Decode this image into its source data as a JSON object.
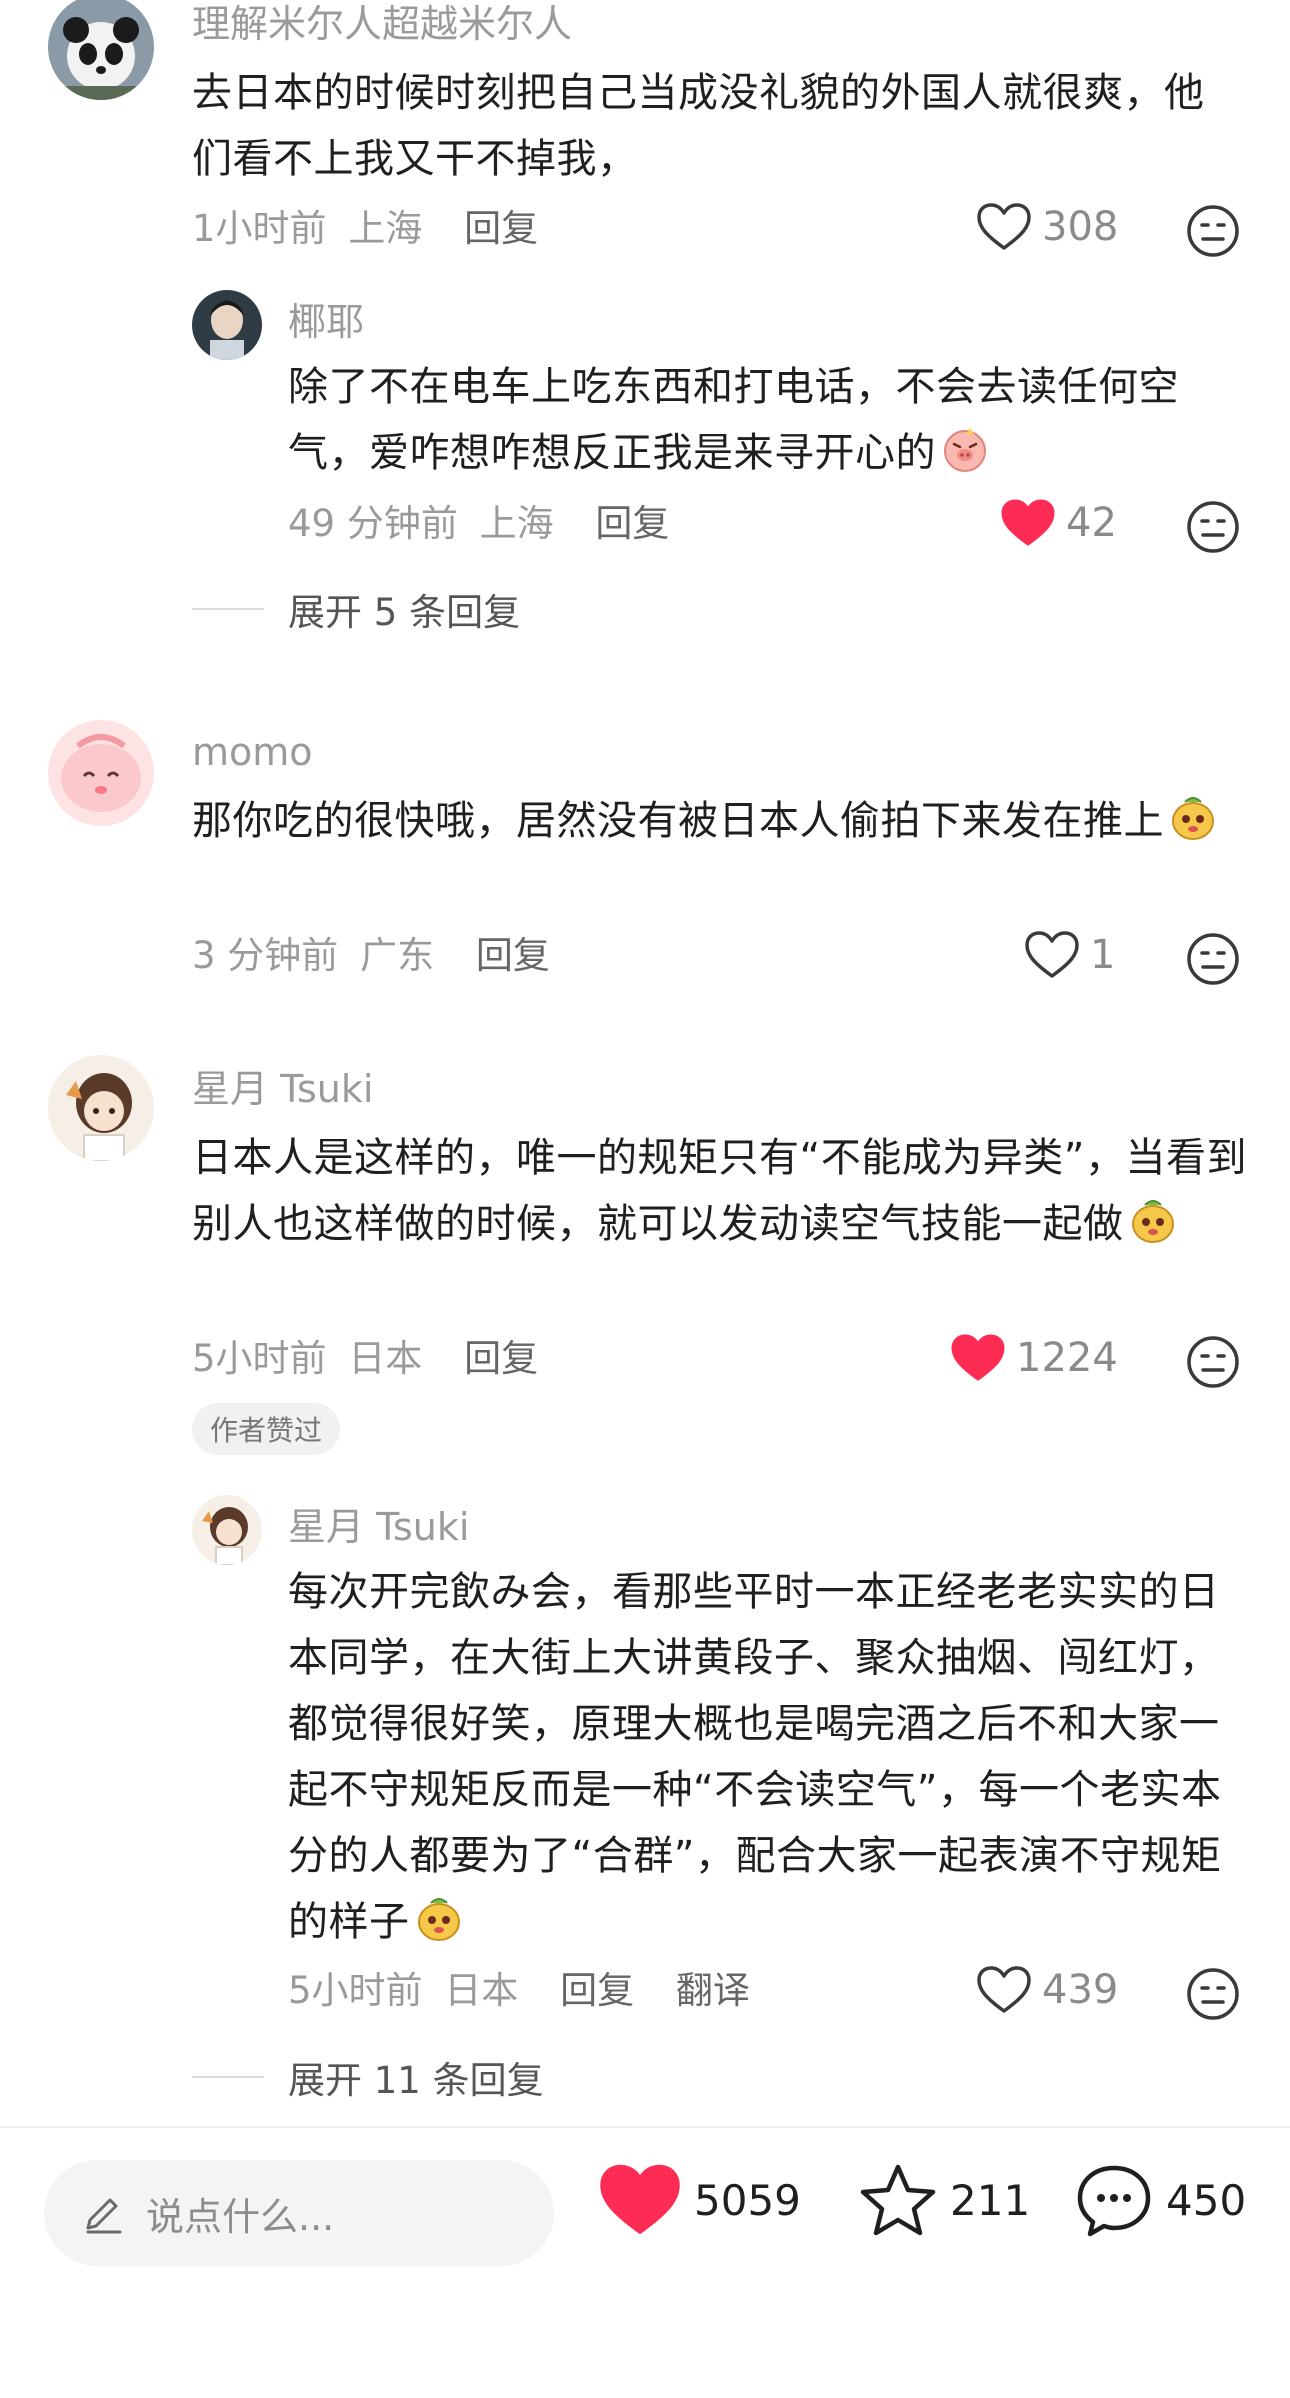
{
  "comments": [
    {
      "username": "理解米尔人超越米尔人",
      "text": "去日本的时候时刻把自己当成没礼貌的外国人就很爽，他们看不上我又干不掉我，",
      "time": "1小时前",
      "location": "上海",
      "reply_label": "回复",
      "likes": "308",
      "liked": false,
      "replies": [
        {
          "username": "椰耶",
          "text": "除了不在电车上吃东西和打电话，不会去读任何空气，爱咋想咋想反正我是来寻开心的",
          "time": "49 分钟前",
          "location": "上海",
          "reply_label": "回复",
          "likes": "42",
          "liked": true
        }
      ],
      "expand_label": "展开 5 条回复"
    },
    {
      "username": "momo",
      "text": "那你吃的很快哦，居然没有被日本人偷拍下来发在推上",
      "time": "3 分钟前",
      "location": "广东",
      "reply_label": "回复",
      "likes": "1",
      "liked": false
    },
    {
      "username": "星月 Tsuki",
      "text": "日本人是这样的，唯一的规矩只有“不能成为异类”，当看到别人也这样做的时候，就可以发动读空气技能一起做",
      "time": "5小时前",
      "location": "日本",
      "reply_label": "回复",
      "likes": "1224",
      "liked": true,
      "badge": "作者赞过",
      "replies": [
        {
          "username": "星月 Tsuki",
          "text": "每次开完飲み会，看那些平时一本正经老老实实的日本同学，在大街上大讲黄段子、聚众抽烟、闯红灯，都觉得很好笑，原理大概也是喝完酒之后不和大家一起不守规矩反而是一种“不会读空气”，每一个老实本分的人都要为了“合群”，配合大家一起表演不守规矩的样子",
          "time": "5小时前",
          "location": "日本",
          "reply_label": "回复",
          "translate_label": "翻译",
          "likes": "439",
          "liked": false
        }
      ],
      "expand_label": "展开 11 条回复"
    }
  ],
  "bottom_bar": {
    "input_placeholder": "说点什么...",
    "likes": "5059",
    "favorites": "211",
    "comments": "450"
  },
  "colors": {
    "like_red": "#fe2c55",
    "muted_text": "#9a9a9a"
  }
}
